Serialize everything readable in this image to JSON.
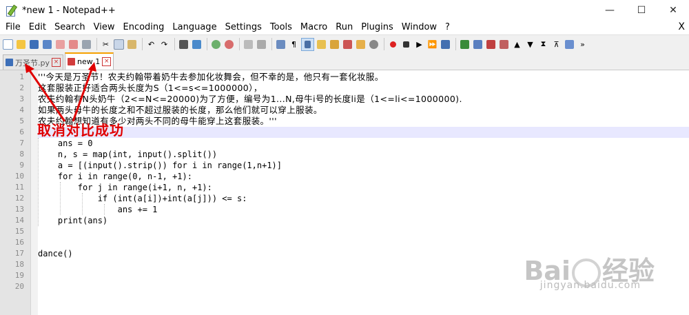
{
  "window": {
    "title": "*new 1 - Notepad++",
    "minimize": "—",
    "maximize": "☐",
    "close": "✕"
  },
  "menu": [
    "File",
    "Edit",
    "Search",
    "View",
    "Encoding",
    "Language",
    "Settings",
    "Tools",
    "Macro",
    "Run",
    "Plugins",
    "Window",
    "?"
  ],
  "menu_close": "X",
  "tabs": [
    {
      "label": "万圣节.py",
      "active": false
    },
    {
      "label": "new 1",
      "active": true
    }
  ],
  "lines": [
    {
      "num": "1",
      "text": "'''今天是万圣节！农夫约翰带着奶牛去参加化妆舞会，但不幸的是，他只有一套化妆服。"
    },
    {
      "num": "2",
      "text": "这套服装正好适合两头长度为S（1<=s<=1000000），"
    },
    {
      "num": "3",
      "text": "农夫约翰有N头奶牛（2<=N<=20000)为了方便，编号为1...N,母牛i号的长度li是（1<=li<=1000000)."
    },
    {
      "num": "4",
      "text": "如果两头母牛的长度之和不超过服装的长度，那么他们就可以穿上服装。"
    },
    {
      "num": "5",
      "text": "农夫约翰想知道有多少对两头不同的母牛能穿上这套服装。'''"
    },
    {
      "num": "6",
      "text": ""
    },
    {
      "num": "7",
      "text": "    ans = 0"
    },
    {
      "num": "8",
      "text": "    n, s = map(int, input().split())"
    },
    {
      "num": "9",
      "text": "    a = [(input().strip()) for i in range(1,n+1)]"
    },
    {
      "num": "10",
      "text": "    for i in range(0, n-1, +1):"
    },
    {
      "num": "11",
      "text": "        for j in range(i+1, n, +1):"
    },
    {
      "num": "12",
      "text": "            if (int(a[i])+int(a[j])) <= s:"
    },
    {
      "num": "13",
      "text": "                ans += 1"
    },
    {
      "num": "14",
      "text": "    print(ans)"
    },
    {
      "num": "15",
      "text": ""
    },
    {
      "num": "16",
      "text": ""
    },
    {
      "num": "17",
      "text": "dance()"
    },
    {
      "num": "18",
      "text": ""
    },
    {
      "num": "19",
      "text": ""
    },
    {
      "num": "20",
      "text": ""
    }
  ],
  "annotation": "取消对比成功",
  "watermark": {
    "brand": "Bai",
    "brand2": "经验",
    "url": "jingyan.baidu.com"
  },
  "colors": {
    "annotation": "#e00000",
    "active_tab_accent": "#f5a000",
    "current_line": "#e8e8ff"
  }
}
